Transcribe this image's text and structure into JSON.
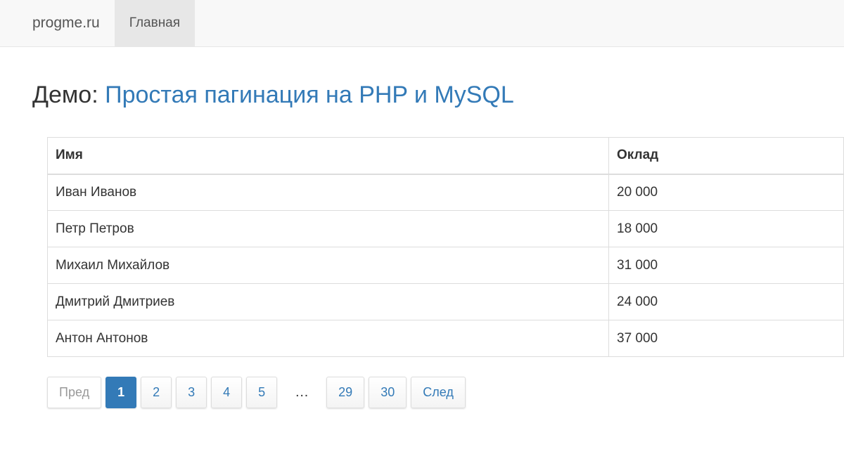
{
  "navbar": {
    "brand": "progme.ru",
    "items": [
      {
        "label": "Главная",
        "active": true
      }
    ]
  },
  "heading": {
    "prefix": "Демо: ",
    "link_text": "Простая пагинация на PHP и MySQL"
  },
  "table": {
    "columns": [
      "Имя",
      "Оклад"
    ],
    "rows": [
      [
        "Иван Иванов",
        "20 000"
      ],
      [
        "Петр Петров",
        "18 000"
      ],
      [
        "Михаил Михайлов",
        "31 000"
      ],
      [
        "Дмитрий Дмитриев",
        "24 000"
      ],
      [
        "Антон Антонов",
        "37 000"
      ]
    ]
  },
  "pagination": {
    "prev_label": "Пред",
    "pages": [
      "1",
      "2",
      "3",
      "4",
      "5"
    ],
    "ellipsis": "…",
    "tail_pages": [
      "29",
      "30"
    ],
    "next_label": "След",
    "current_page": "1"
  },
  "colors": {
    "accent": "#337ab7",
    "navbar_bg": "#f8f8f8",
    "border": "#dddddd"
  }
}
